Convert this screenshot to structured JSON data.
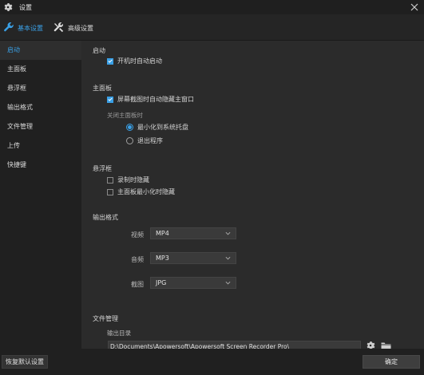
{
  "window": {
    "title": "设置"
  },
  "tabs": [
    {
      "label": "基本设置",
      "icon": "wrench-icon",
      "active": true
    },
    {
      "label": "高级设置",
      "icon": "tools-icon",
      "active": false
    }
  ],
  "sidebar": {
    "items": [
      {
        "label": "启动",
        "active": true
      },
      {
        "label": "主面板",
        "active": false
      },
      {
        "label": "悬浮框",
        "active": false
      },
      {
        "label": "输出格式",
        "active": false
      },
      {
        "label": "文件管理",
        "active": false
      },
      {
        "label": "上传",
        "active": false
      },
      {
        "label": "快捷键",
        "active": false
      }
    ]
  },
  "startup": {
    "title": "启动",
    "auto_start": {
      "label": "开机时自动启动",
      "checked": true
    }
  },
  "main_panel": {
    "title": "主面板",
    "hide_on_screenshot": {
      "label": "屏幕截图时自动隐藏主窗口",
      "checked": true
    },
    "close_label": "关闭主面板时",
    "radio_minimize": {
      "label": "最小化到系统托盘",
      "selected": true
    },
    "radio_exit": {
      "label": "退出程序",
      "selected": false
    }
  },
  "floating": {
    "title": "悬浮框",
    "hide_recording": {
      "label": "录制时隐藏",
      "checked": false
    },
    "hide_minimized": {
      "label": "主面板最小化时隐藏",
      "checked": false
    }
  },
  "output_format": {
    "title": "输出格式",
    "video": {
      "label": "视频",
      "value": "MP4"
    },
    "audio": {
      "label": "音频",
      "value": "MP3"
    },
    "screenshot": {
      "label": "截图",
      "value": "JPG"
    }
  },
  "file_mgmt": {
    "title": "文件管理",
    "output_dir_label": "输出目录",
    "output_dir_value": "D:\\Documents\\Apowersoft\\Apowersoft Screen Recorder Pro\\"
  },
  "footer": {
    "reset_label": "恢复默认设置",
    "ok_label": "确定"
  },
  "colors": {
    "accent": "#3aa0e6",
    "background": "#2b2b2b",
    "sidebar": "#202020"
  }
}
